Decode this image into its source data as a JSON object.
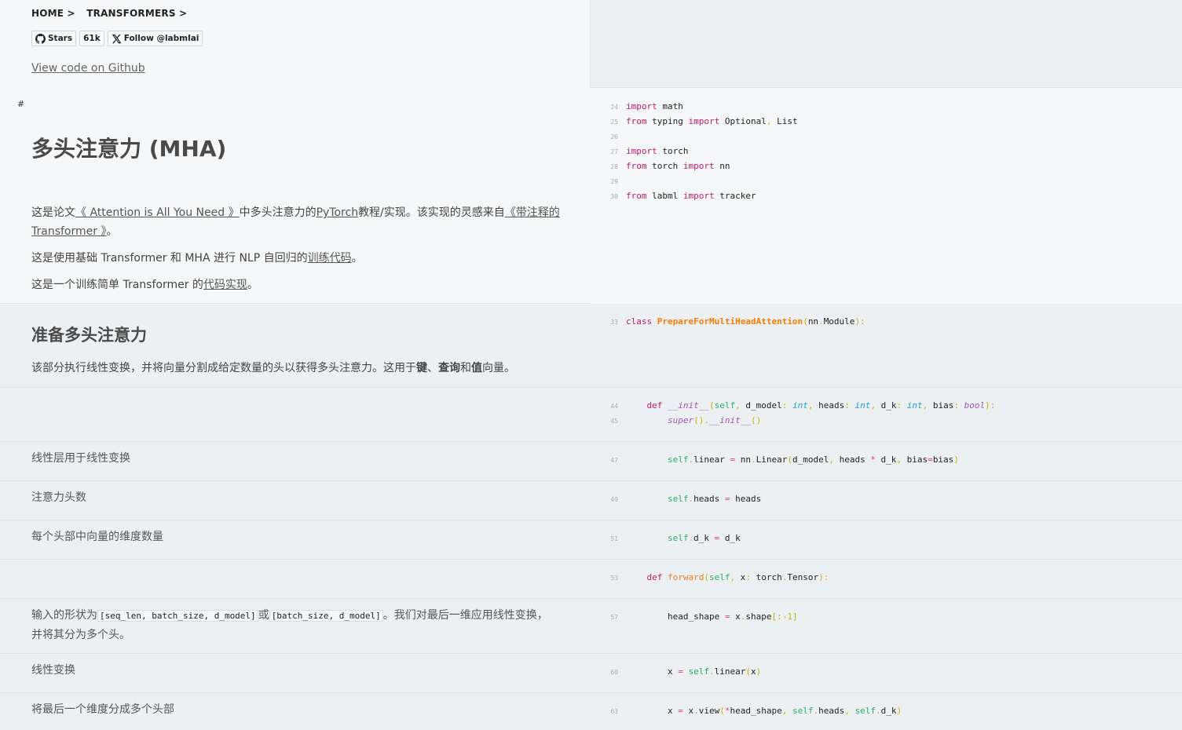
{
  "breadcrumb": [
    "HOME >",
    "TRANSFORMERS >"
  ],
  "badges": {
    "stars": "Stars",
    "count": "61k",
    "follow": "Follow @labmlai"
  },
  "github_link": "View code on Github",
  "intro": {
    "hash": "#",
    "title": "多头注意力 (MHA)",
    "p1_a": "这是论文",
    "p1_link1": "《 Attention is All You Need 》",
    "p1_b": "中多头注意力的",
    "p1_link2": "PyTorch",
    "p1_c": "教程/实现。该实现的灵感来自",
    "p1_link3": "《带注释的 Transformer 》",
    "p1_d": "。",
    "p2_a": "这是使用基础 Transformer 和 MHA 进行 NLP 自回归的",
    "p2_link": "训练代码",
    "p2_b": "。",
    "p3_a": "这是一个训练简单 Transformer 的",
    "p3_link": "代码实现",
    "p3_b": "。"
  },
  "imports": [
    {
      "n": "24",
      "t": "import math"
    },
    {
      "n": "25",
      "t": "from typing import Optional, List"
    },
    {
      "n": "26",
      "t": ""
    },
    {
      "n": "27",
      "t": "import torch"
    },
    {
      "n": "28",
      "t": "from torch import nn"
    },
    {
      "n": "29",
      "t": ""
    },
    {
      "n": "30",
      "t": "from labml import tracker"
    }
  ],
  "section": {
    "title": "准备多头注意力",
    "desc_a": "该部分执行线性变换，并将向量分割成给定数量的头以获得多头注意力。这用于",
    "desc_k1": "键",
    "desc_s1": "、",
    "desc_k2": "查询",
    "desc_s2": "和",
    "desc_k3": "值",
    "desc_b": "向量。",
    "class_ln": "33"
  },
  "rows": [
    {
      "doc": "",
      "lines": [
        "44",
        "45"
      ]
    },
    {
      "doc": "线性层用于线性变换",
      "lines": [
        "47"
      ]
    },
    {
      "doc": "注意力头数",
      "lines": [
        "49"
      ]
    },
    {
      "doc": "每个头部中向量的维度数量",
      "lines": [
        "51"
      ]
    },
    {
      "doc": "",
      "lines": [
        "53"
      ]
    },
    {
      "doc_a": "输入的形状为",
      "code1": "[seq_len, batch_size, d_model]",
      "doc_b": "或",
      "code2": "[batch_size, d_model]",
      "doc_c": "。我们对最后一维应用线性变换，",
      "doc_d": "并将其分为多个头。",
      "lines": [
        "57"
      ]
    },
    {
      "doc": "线性变换",
      "lines": [
        "60"
      ]
    },
    {
      "doc": "将最后一个维度分成多个头部",
      "lines": [
        "63"
      ]
    }
  ]
}
